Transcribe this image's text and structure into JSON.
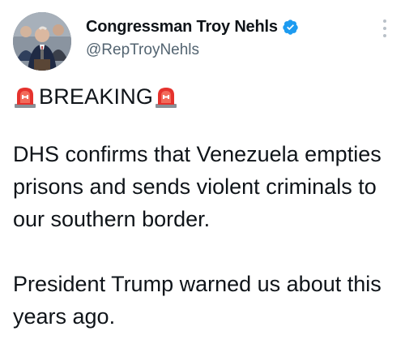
{
  "author": {
    "display_name": "Congressman Troy Nehls",
    "handle": "@RepTroyNehls",
    "avatar_icon": "profile-photo",
    "verified_icon": "verified-badge-icon",
    "verified_color": "#1d9bf0"
  },
  "menu_icon": "more-options-icon",
  "tweet": {
    "headline": "BREAKING",
    "headline_icon": "police-car-light-icon",
    "paragraph_1": "DHS confirms that Venezuela empties prisons and sends violent criminals to our southern border.",
    "paragraph_2": "President Trump warned us about this years ago."
  }
}
